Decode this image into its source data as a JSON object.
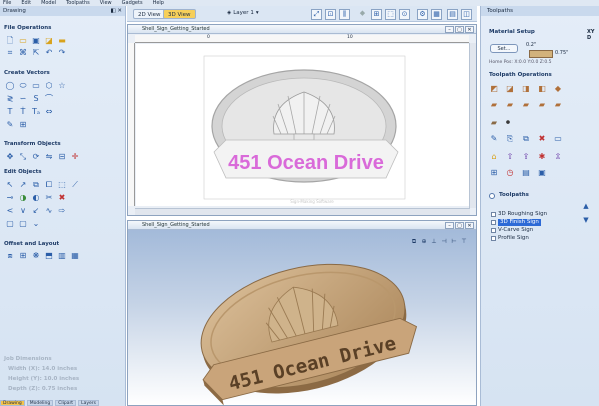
{
  "menu": [
    "File",
    "Edit",
    "Model",
    "Toolpaths",
    "View",
    "Gadgets",
    "Help"
  ],
  "left_panel": {
    "title": "Drawing",
    "sections": {
      "file_ops": "File Operations",
      "create_vectors": "Create Vectors",
      "transform": "Transform Objects",
      "edit_objects": "Edit Objects",
      "offset_layout": "Offset and Layout"
    },
    "job_dimensions": {
      "title": "Job Dimensions",
      "width": "Width  (X): 14.0 inches",
      "height": "Height (Y): 10.0 inches",
      "depth": "Depth  (Z): 0.75 inches"
    },
    "bottom_tabs": [
      "Drawing",
      "Modeling",
      "Clipart",
      "Layers"
    ]
  },
  "toolbar": {
    "tab_2d": "2D View",
    "tab_3d": "3D View",
    "layer": "Layer 1"
  },
  "view2d": {
    "title": "Shell_Sign_Getting_Started",
    "ruler_marks": [
      "0",
      "10"
    ],
    "sign_text": "451 Ocean Drive",
    "watermark": "Sign-Making Software"
  },
  "view3d": {
    "title": "Shell_Sign_Getting_Started",
    "sign_text": "451 Ocean Drive"
  },
  "right_panel": {
    "title": "Toolpaths",
    "material_setup": "Material Setup",
    "set_button": "Set...",
    "home_pos": "Home Pos: X:0.0 Y:0.0 Z:0.5",
    "z_value": "0.2\"",
    "xy_label": "XY D",
    "depth_label": "0.75\"",
    "ops_title": "Toolpath Operations",
    "list_title": "Toolpaths",
    "toolpaths": [
      {
        "name": "3D Roughing Sign",
        "selected": false
      },
      {
        "name": "3D Finish Sign",
        "selected": true
      },
      {
        "name": "V-Carve Sign",
        "selected": false
      },
      {
        "name": "Profile Sign",
        "selected": false
      }
    ]
  },
  "colors": {
    "accent": "#f6cf5a",
    "sign_text_2d": "#d96ad9",
    "wood": "#c9a47a",
    "selection": "#2d6ad6"
  }
}
